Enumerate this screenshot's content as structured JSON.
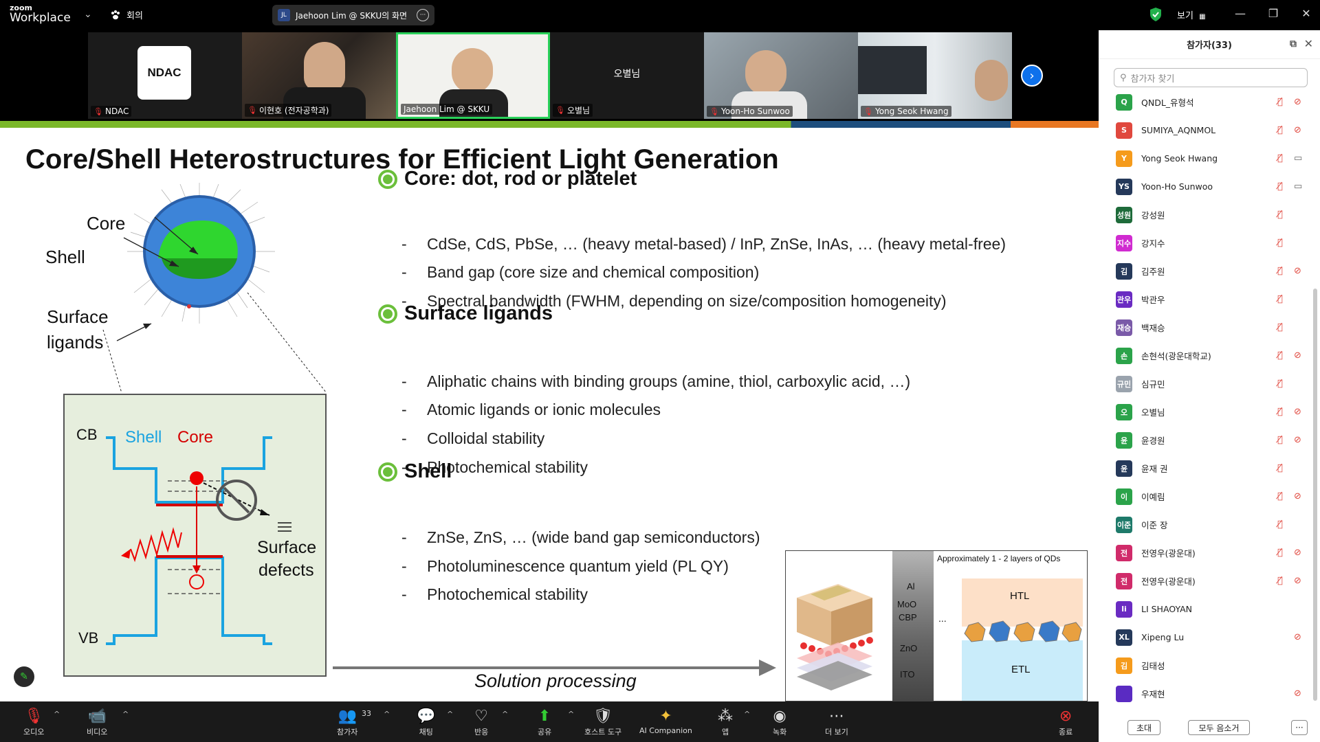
{
  "app": {
    "brand_small": "zoom",
    "brand_big": "Workplace"
  },
  "topbar": {
    "meeting_label": "회의",
    "share": {
      "avatar": "JL",
      "text": "Jaehoon Lim @ SKKU의 화면"
    },
    "view_label": "보기",
    "icons": {
      "meeting": "paw-icon",
      "shield": "shield-check-icon",
      "grid": "grid-icon"
    }
  },
  "gallery": {
    "tiles": [
      {
        "name": "NDAC",
        "logo_text": "NDAC",
        "muted": true
      },
      {
        "name": "이현호 (전자공학과)",
        "muted": true
      },
      {
        "name": "Jaehoon Lim @ SKKU",
        "muted": false,
        "active": true
      },
      {
        "name": "오별님",
        "center_text": "오별님",
        "muted": true
      },
      {
        "name": "Yoon-Ho Sunwoo",
        "muted": true
      },
      {
        "name": "Yong Seok Hwang",
        "muted": true
      }
    ]
  },
  "slide": {
    "title": "Core/Shell Heterostructures for Efficient Light Generation",
    "sections": [
      {
        "heading": "Core: dot, rod or platelet",
        "items": [
          "CdSe, CdS, PbSe, … (heavy metal-based) / InP, ZnSe, InAs, … (heavy metal-free)",
          "Band gap (core size and chemical composition)",
          "Spectral bandwidth (FWHM, depending on size/composition homogeneity)"
        ]
      },
      {
        "heading": "Surface ligands",
        "items": [
          "Aliphatic chains with binding groups (amine, thiol, carboxylic acid, …)",
          "Atomic ligands or ionic molecules",
          "Colloidal stability",
          "Photochemical stability"
        ]
      },
      {
        "heading": "Shell",
        "items": [
          "ZnSe, ZnS, … (wide band gap semiconductors)",
          "Photoluminescence quantum yield (PL QY)",
          "Photochemical stability"
        ]
      }
    ],
    "qd_labels": {
      "core": "Core",
      "shell": "Shell",
      "ligands_1": "Surface",
      "ligands_2": "ligands"
    },
    "band_diagram": {
      "cb": "CB",
      "vb": "VB",
      "shell": "Shell",
      "core": "Core",
      "defects_1": "Surface",
      "defects_2": "defects"
    },
    "process_label": "Solution processing",
    "device": {
      "caption": "Approximately 1 - 2 layers of QDs",
      "layers": [
        "Al",
        "MoO",
        "CBP",
        "ZnO",
        "ITO"
      ],
      "dots": "...",
      "htl": "HTL",
      "etl": "ETL"
    }
  },
  "toolbar": {
    "audio": "오디오",
    "video": "비디오",
    "participants": "참가자",
    "participants_count": "33",
    "chat": "채팅",
    "react": "반응",
    "share": "공유",
    "host_tools": "호스트 도구",
    "ai": "AI Companion",
    "apps": "앱",
    "record": "녹화",
    "more": "더 보기",
    "end": "종료"
  },
  "panel": {
    "title": "참가자(33)",
    "search_placeholder": "참가자 찾기",
    "invite": "초대",
    "mute_all": "모두 음소거",
    "more": "···",
    "participants": [
      {
        "avatar": "Q",
        "color": "#2ba34a",
        "name": "QNDL_유형석",
        "mic": "off",
        "video": "off"
      },
      {
        "avatar": "S",
        "color": "#e0483e",
        "name": "SUMIYA_AQNMOL",
        "mic": "off",
        "video": "off"
      },
      {
        "avatar": "Y",
        "color": "#f59b1c",
        "name": "Yong Seok Hwang",
        "mic": "off",
        "video": "on"
      },
      {
        "avatar": "YS",
        "color": "#25395a",
        "name": "Yoon-Ho Sunwoo",
        "mic": "off",
        "video": "on"
      },
      {
        "avatar": "성원",
        "color": "#1e6b3a",
        "name": "강성원",
        "mic": "off",
        "video": "none"
      },
      {
        "avatar": "지수",
        "color": "#d02bd0",
        "name": "강지수",
        "mic": "off",
        "video": "none"
      },
      {
        "avatar": "김",
        "color": "#25395a",
        "name": "김주원",
        "mic": "off",
        "video": "off"
      },
      {
        "avatar": "관우",
        "color": "#6a2bc2",
        "name": "박관우",
        "mic": "off",
        "video": "none"
      },
      {
        "avatar": "재승",
        "color": "#7a5aa8",
        "name": "백재승",
        "mic": "off",
        "video": "none"
      },
      {
        "avatar": "손",
        "color": "#2ba34a",
        "name": "손현석(광운대학교)",
        "mic": "off",
        "video": "off"
      },
      {
        "avatar": "규민",
        "color": "#9aa3ad",
        "name": "심규민",
        "mic": "off",
        "video": "none"
      },
      {
        "avatar": "오",
        "color": "#2ba34a",
        "name": "오별님",
        "mic": "off",
        "video": "off"
      },
      {
        "avatar": "윤",
        "color": "#2ba34a",
        "name": "윤경원",
        "mic": "off",
        "video": "off"
      },
      {
        "avatar": "윤",
        "color": "#25395a",
        "name": "윤재 권",
        "mic": "off",
        "video": "none"
      },
      {
        "avatar": "이",
        "color": "#2ba34a",
        "name": "이예림",
        "mic": "off",
        "video": "off"
      },
      {
        "avatar": "이준",
        "color": "#1e7a6a",
        "name": "이준 장",
        "mic": "off",
        "video": "none"
      },
      {
        "avatar": "전",
        "color": "#d02b6a",
        "name": "전영우(광운대)",
        "mic": "off",
        "video": "off"
      },
      {
        "avatar": "전",
        "color": "#d02b6a",
        "name": "전영우(광운대)",
        "mic": "off",
        "video": "off"
      },
      {
        "avatar": "li",
        "color": "#6a2bc2",
        "name": "LI SHAOYAN",
        "mic": "none",
        "video": "none"
      },
      {
        "avatar": "XL",
        "color": "#25395a",
        "name": "Xipeng Lu",
        "mic": "none",
        "video": "off"
      },
      {
        "avatar": "김",
        "color": "#f59b1c",
        "name": "김태성",
        "mic": "none",
        "video": "none"
      },
      {
        "avatar": "",
        "color": "#5a2bc2",
        "name": "우재현",
        "mic": "none",
        "video": "off"
      }
    ]
  }
}
